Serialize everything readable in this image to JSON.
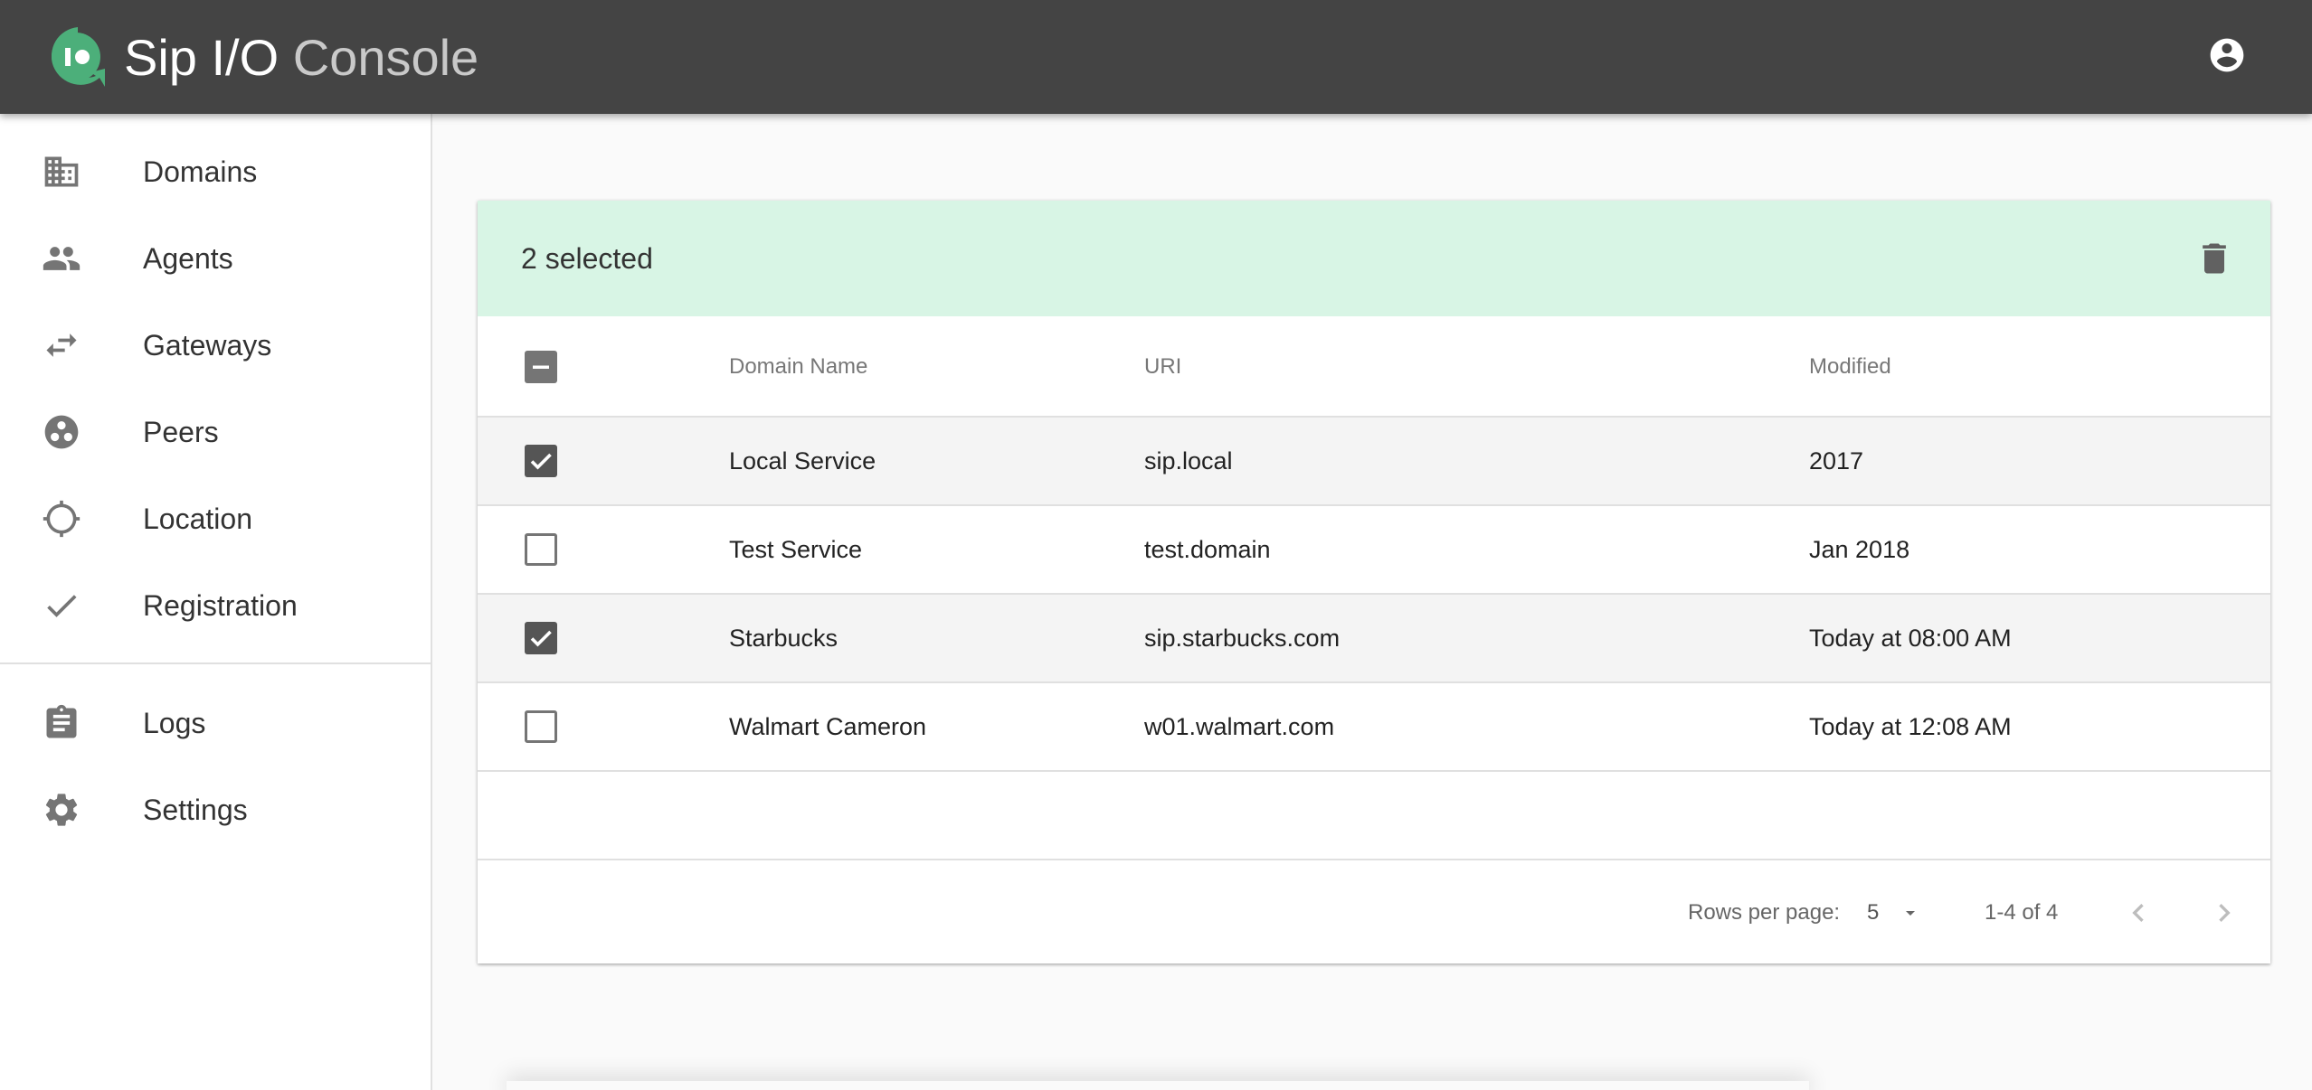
{
  "app": {
    "name": "Sip I/O",
    "suffix": "Console"
  },
  "icons": {
    "logo": "sipio-logo-icon",
    "account": "account-circle-icon",
    "delete": "trash-icon",
    "sidebar": [
      "domain-building-icon",
      "people-icon",
      "swap-arrows-icon",
      "peers-icon",
      "location-crosshair-icon",
      "check-icon",
      "clipboard-icon",
      "gear-icon"
    ]
  },
  "colors": {
    "appbar": "#444444",
    "logo": "#4caf7a",
    "selection_bar": "#d8f5e5",
    "checkbox": "#555555"
  },
  "sidebar": {
    "items": [
      {
        "label": "Domains"
      },
      {
        "label": "Agents"
      },
      {
        "label": "Gateways"
      },
      {
        "label": "Peers"
      },
      {
        "label": "Location"
      },
      {
        "label": "Registration"
      },
      {
        "label": "Logs"
      },
      {
        "label": "Settings"
      }
    ]
  },
  "table": {
    "selected_label": "2 selected",
    "columns": [
      "Domain Name",
      "URI",
      "Modified"
    ],
    "select_all_state": "indeterminate",
    "rows": [
      {
        "name": "Local Service",
        "uri": "sip.local",
        "modified": "2017",
        "selected": true
      },
      {
        "name": "Test Service",
        "uri": "test.domain",
        "modified": "Jan 2018",
        "selected": false
      },
      {
        "name": "Starbucks",
        "uri": "sip.starbucks.com",
        "modified": "Today at 08:00 AM",
        "selected": true
      },
      {
        "name": "Walmart Cameron",
        "uri": "w01.walmart.com",
        "modified": "Today at 12:08 AM",
        "selected": false
      }
    ],
    "footer": {
      "rows_per_page_label": "Rows per page:",
      "rows_per_page_value": "5",
      "range_label": "1-4 of 4"
    }
  }
}
